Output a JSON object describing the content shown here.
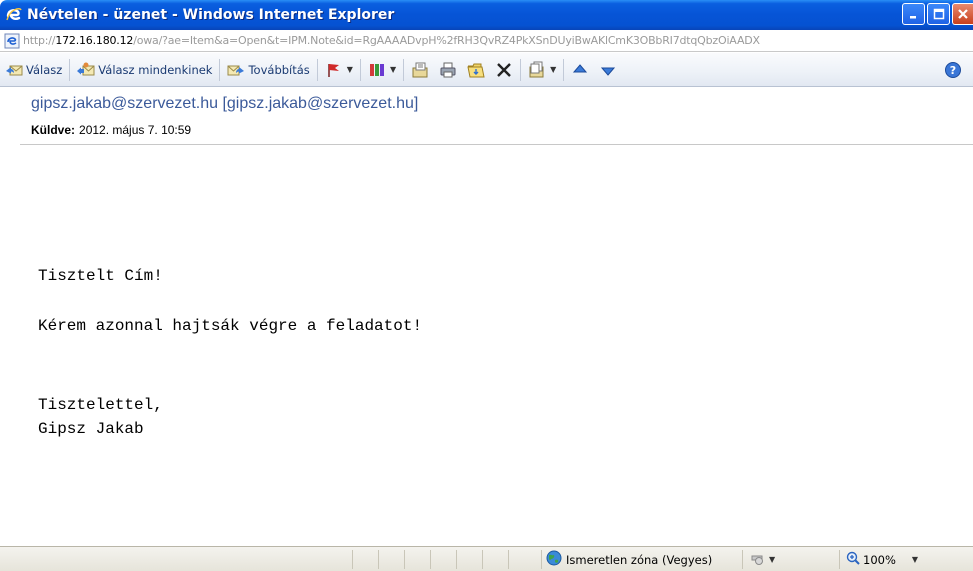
{
  "window": {
    "title": "Névtelen - üzenet - Windows Internet Explorer"
  },
  "address": {
    "prefix": "http://",
    "host": "172.16.180.12",
    "path": "/owa/?ae=Item&a=Open&t=IPM.Note&id=RgAAAADvpH%2fRH3QvRZ4PkXSnDUyiBwAKlCmK3OBbRI7dtqQbzOiAADX"
  },
  "toolbar": {
    "reply_label": "Válasz",
    "reply_all_label": "Válasz mindenkinek",
    "forward_label": "Továbbítás"
  },
  "message": {
    "sender": "gipsz.jakab@szervezet.hu [gipsz.jakab@szervezet.hu]",
    "sent_label": "Küldve:",
    "sent_value": "2012. május 7. 10:59",
    "body": {
      "greeting": "Tisztelt Cím!",
      "line1": "Kérem azonnal hajtsák végre a feladatot!",
      "closing": "Tisztelettel,",
      "signature": "Gipsz Jakab"
    }
  },
  "status": {
    "zone": "Ismeretlen zóna (Vegyes)",
    "zoom": "100%"
  },
  "icons": {
    "title": "ie-logo-icon",
    "close": "close-icon"
  },
  "colors": {
    "titlebar": "#0654d6",
    "sender_link": "#3b5a9a",
    "close_button": "#c8401d"
  }
}
